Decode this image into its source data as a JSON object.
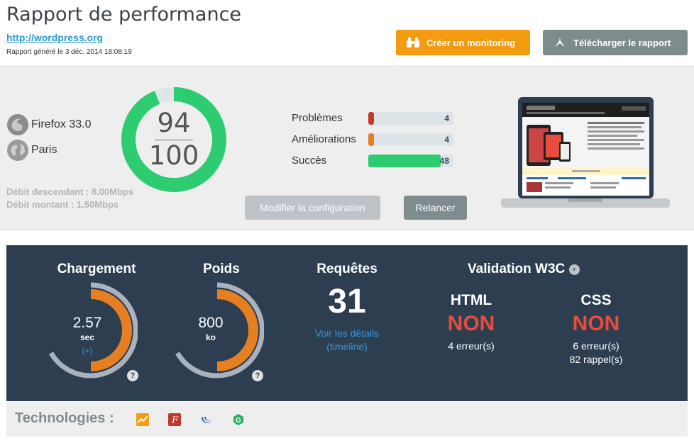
{
  "header": {
    "title": "Rapport de performance",
    "url": "http://wordpress.org",
    "generated": "Rapport généré le 3 déc. 2014 18:08:19",
    "monitor_button": "Créer un monitoring",
    "download_button": "Télécharger le rapport"
  },
  "summary": {
    "browser": "Firefox 33.0",
    "location": "Paris",
    "down": "Débit descendant : 8.00Mbps",
    "up": "Débit montant : 1.50Mbps",
    "score": "94",
    "score_max": "100",
    "score_fraction": 0.94,
    "stats": [
      {
        "label": "Problèmes",
        "value": "4",
        "color": "#c0392b",
        "fraction": 0.07
      },
      {
        "label": "Améliorations",
        "value": "4",
        "color": "#e67e22",
        "fraction": 0.07
      },
      {
        "label": "Succès",
        "value": "48",
        "color": "#2ecc71",
        "fraction": 0.85
      }
    ],
    "config_button": "Modifier la configuration",
    "rerun_button": "Relancer"
  },
  "metrics": {
    "load": {
      "title": "Chargement",
      "value": "2.57",
      "unit": "sec",
      "extra": "(+)",
      "fraction": 0.5
    },
    "weight": {
      "title": "Poids",
      "value": "800",
      "unit": "ko",
      "fraction": 0.5
    },
    "requests": {
      "title": "Requêtes",
      "value": "31",
      "link1": "Voir les détails",
      "link2": "(timeline)"
    },
    "w3c": {
      "title": "Validation W3C",
      "html_label": "HTML",
      "html_result": "NON",
      "html_errors": "4 erreur(s)",
      "css_label": "CSS",
      "css_result": "NON",
      "css_errors": "6 erreur(s)",
      "css_reminders": "82 rappel(s)"
    }
  },
  "technologies": {
    "label": "Technologies :",
    "icons": [
      "analytics-icon",
      "font-icon",
      "jquery-icon",
      "gzip-icon"
    ]
  },
  "colors": {
    "accent_orange": "#f39c12",
    "gauge_orange": "#e67e22",
    "score_green": "#2ecc71",
    "dark_panel": "#2c3e50",
    "fail_red": "#e74c3c",
    "link_blue": "#3498db"
  }
}
